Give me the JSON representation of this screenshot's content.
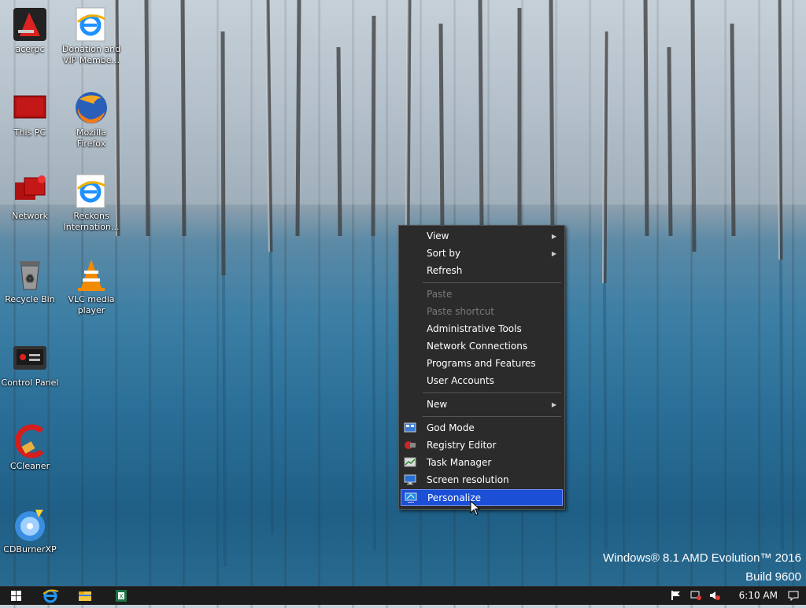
{
  "desktop": {
    "icons": [
      {
        "label": "acerpc"
      },
      {
        "label": "Donation and VIP Membe..."
      },
      {
        "label": "This PC"
      },
      {
        "label": "Mozilla Firefox"
      },
      {
        "label": "Network"
      },
      {
        "label": "Reckons Internation..."
      },
      {
        "label": "Recycle Bin"
      },
      {
        "label": "VLC media player"
      },
      {
        "label": "Control Panel"
      },
      {
        "label": "CCleaner"
      },
      {
        "label": "CDBurnerXP"
      }
    ]
  },
  "context_menu": {
    "items": [
      {
        "label": "View",
        "submenu": true
      },
      {
        "label": "Sort by",
        "submenu": true
      },
      {
        "label": "Refresh"
      },
      {
        "label": "Paste",
        "disabled": true
      },
      {
        "label": "Paste shortcut",
        "disabled": true
      },
      {
        "label": "Administrative Tools"
      },
      {
        "label": "Network Connections"
      },
      {
        "label": "Programs and Features"
      },
      {
        "label": "User Accounts"
      },
      {
        "label": "New",
        "submenu": true
      },
      {
        "label": "God Mode"
      },
      {
        "label": "Registry Editor"
      },
      {
        "label": "Task Manager"
      },
      {
        "label": "Screen resolution"
      },
      {
        "label": "Personalize",
        "highlighted": true
      }
    ],
    "arrow_glyph": "▶"
  },
  "watermark": {
    "line1": "Windows® 8.1 AMD Evolution™ 2016",
    "line2": "Build 9600"
  },
  "taskbar": {
    "clock": "6:10 AM",
    "pinned": [
      "start-icon",
      "internet-explorer-icon",
      "file-explorer-icon",
      "excel-icon"
    ],
    "tray": [
      "action-center-flag-icon",
      "network-icon",
      "volume-muted-icon",
      "notifications-icon"
    ]
  },
  "colors": {
    "menu_bg": "#2b2b2b",
    "menu_highlight": "#1a4fd6",
    "taskbar_bg": "#1c1c1c"
  }
}
